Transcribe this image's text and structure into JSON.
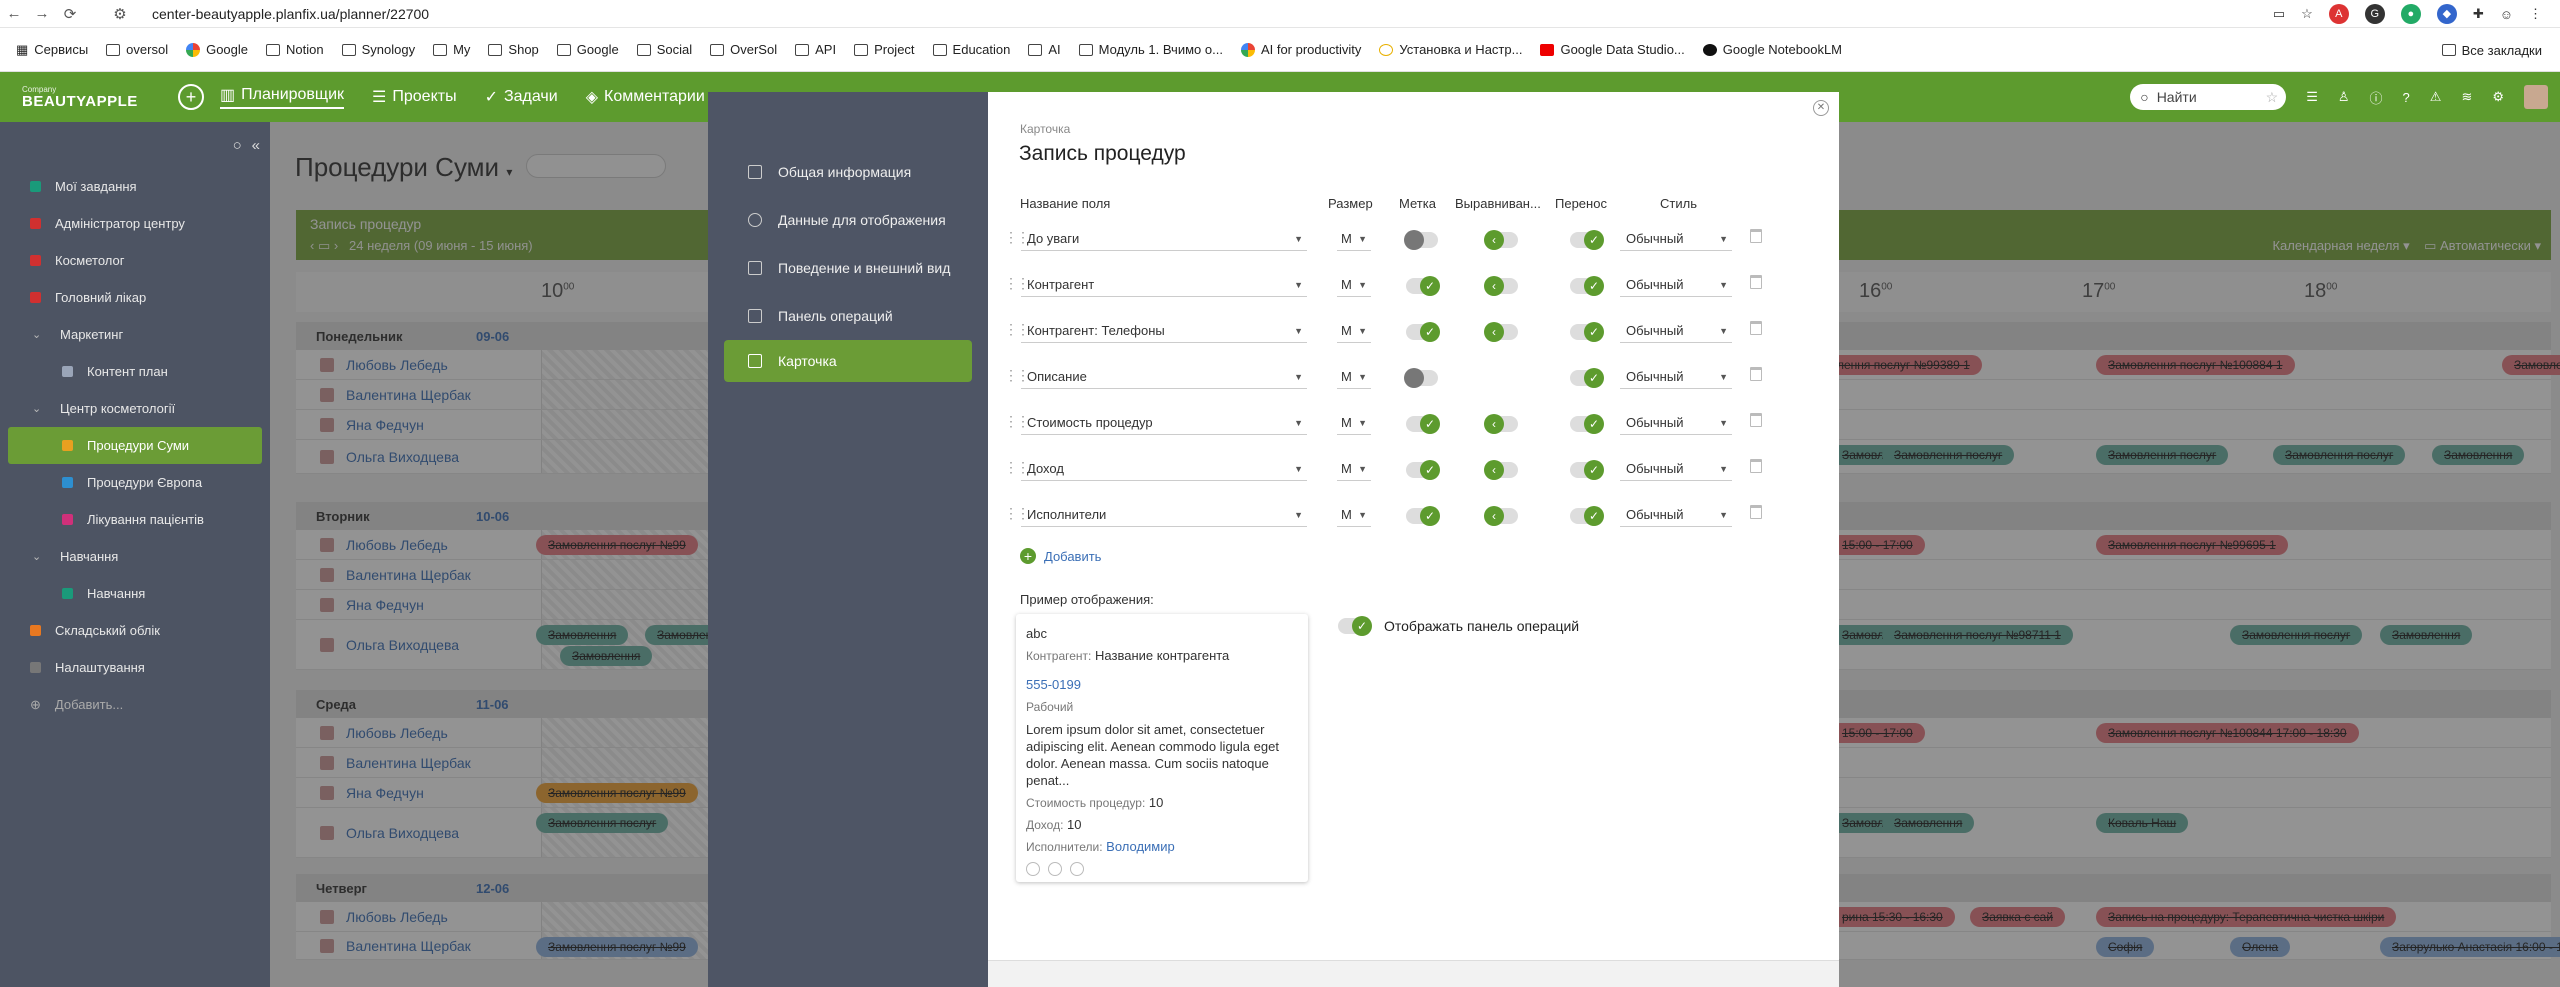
{
  "browser": {
    "url": "center-beautyapple.planfix.ua/planner/22700",
    "bookmarks": [
      "Сервисы",
      "oversol",
      "Google",
      "Notion",
      "Synology",
      "My",
      "Shop",
      "Google",
      "Social",
      "OverSol",
      "API",
      "Project",
      "Education",
      "AI",
      "Модуль 1. Вчимо о...",
      "AI for productivity",
      "Установка и Настр...",
      "Google Data Studio...",
      "Google NotebookLM"
    ],
    "all_bookmarks": "Все закладки"
  },
  "header": {
    "company_small": "Company",
    "company": "BEAUTYAPPLE",
    "nav": [
      "Планировщик",
      "Проекты",
      "Задачи",
      "Комментарии"
    ],
    "search_placeholder": "Найти"
  },
  "sidebar": {
    "items": [
      {
        "label": "Мої завдання",
        "color": "#1a9a7a",
        "kind": "top"
      },
      {
        "label": "Адміністратор центру",
        "color": "#d03030",
        "kind": "top"
      },
      {
        "label": "Косметолог",
        "color": "#d03030",
        "kind": "top"
      },
      {
        "label": "Головний лікар",
        "color": "#d03030",
        "kind": "top"
      },
      {
        "label": "Маркетинг",
        "kind": "group"
      },
      {
        "label": "Контент план",
        "color": "#9aa5b8",
        "kind": "sub"
      },
      {
        "label": "Центр косметології",
        "kind": "group"
      },
      {
        "label": "Процедури Суми",
        "color": "#e8a020",
        "kind": "active"
      },
      {
        "label": "Процедури Європа",
        "color": "#2d8fd0",
        "kind": "sub"
      },
      {
        "label": "Лікування пацієнтів",
        "color": "#d0307a",
        "kind": "sub"
      },
      {
        "label": "Навчання",
        "kind": "group"
      },
      {
        "label": "Навчання",
        "color": "#1a9a7a",
        "kind": "sub"
      },
      {
        "label": "Складський облік",
        "color": "#e87820",
        "kind": "top"
      },
      {
        "label": "Налаштування",
        "color": "#777",
        "kind": "top"
      },
      {
        "label": "Добавить...",
        "kind": "add"
      }
    ]
  },
  "planner": {
    "title": "Процедури Суми",
    "bar_title": "Запись процедур",
    "week": "24 неделя (09 июня - 15 июня)",
    "view": "Календарная неделя",
    "mode": "Автоматически",
    "hours": [
      "10",
      "16",
      "17",
      "18"
    ],
    "days": [
      {
        "name": "Понедельник",
        "date": "09-06"
      },
      {
        "name": "Вторник",
        "date": "10-06"
      },
      {
        "name": "Среда",
        "date": "11-06"
      },
      {
        "name": "Четверг",
        "date": "12-06"
      }
    ],
    "people": [
      "Любовь Лебедь",
      "Валентина Щербак",
      "Яна Федчун",
      "Ольга Виходцева"
    ],
    "events": {
      "e1": "Замовлення послуг №99389 1",
      "e2": "Замовлення послуг №100884 1",
      "e3": "Замовлення послуг №99",
      "e4": "Замовлення",
      "e5": "Замовлення послуг",
      "e6": "Замовлення послуг",
      "e7": "Замовлення послуг",
      "e8": "Замовлення",
      "e9": "Замовлення послуг №99",
      "e10": "15:00 - 17:00",
      "e11": "Замовлення послуг №99695 1",
      "e12": "Замовлення",
      "e13": "Замовлення",
      "e14": "Замовлення",
      "e15": "Замовлення послуг №98711 1",
      "e16": "Замовлення послуг",
      "e17": "Замовлення",
      "e18": "Замовлення",
      "e19": "15:00 - 17:00",
      "e20": "Замовлення послуг №100844 17:00 - 18:30",
      "e21": "Замовлення послуг №99",
      "e22": "Замовлення послуг",
      "e23": "Замовлення",
      "e24": "Замовлення",
      "e25": "Коваль Наш",
      "e26": "рина 15:30 - 16:30",
      "e27": "Заявка с сай",
      "e28": "Запись на процедуру: Терапевтична чистка шкіри",
      "e29": "Замовлення послуг №99",
      "e30": "Софія",
      "e31": "Олена",
      "e32": "Загорулько Анастасія 16:00 - 17"
    }
  },
  "modal": {
    "nav": [
      "Общая информация",
      "Данные для отображения",
      "Поведение и внешний вид",
      "Панель операций",
      "Карточка"
    ],
    "crumb": "Карточка",
    "title": "Запись процедур",
    "cols": {
      "field": "Название поля",
      "size": "Размер",
      "mark": "Метка",
      "align": "Выравниван...",
      "wrap": "Перенос",
      "style": "Стиль"
    },
    "rows": [
      {
        "field": "До уваги",
        "size": "M",
        "style": "Обычный",
        "mark": false,
        "align": true,
        "wrap": true
      },
      {
        "field": "Контрагент",
        "size": "M",
        "style": "Обычный",
        "mark": true,
        "align": true,
        "wrap": true
      },
      {
        "field": "Контрагент: Телефоны",
        "size": "M",
        "style": "Обычный",
        "mark": true,
        "align": true,
        "wrap": true
      },
      {
        "field": "Описание",
        "size": "M",
        "style": "Обычный",
        "mark": false,
        "align": null,
        "wrap": true
      },
      {
        "field": "Стоимость процедур",
        "size": "M",
        "style": "Обычный",
        "mark": true,
        "align": true,
        "wrap": true
      },
      {
        "field": "Доход",
        "size": "M",
        "style": "Обычный",
        "mark": true,
        "align": true,
        "wrap": true
      },
      {
        "field": "Исполнители",
        "size": "M",
        "style": "Обычный",
        "mark": true,
        "align": true,
        "wrap": true
      }
    ],
    "add": "Добавить",
    "example_label": "Пример отображения:",
    "card": {
      "line1": "abc",
      "contractor_label": "Контрагент:",
      "contractor": "Название контрагента",
      "phone": "555-0199",
      "phone_type": "Рабочий",
      "desc": "Lorem ipsum dolor sit amet, consectetuer adipiscing elit. Aenean commodo ligula eget dolor. Aenean massa. Cum sociis natoque penat...",
      "cost_label": "Стоимость процедур:",
      "cost": "10",
      "income_label": "Доход:",
      "income": "10",
      "exec_label": "Исполнители:",
      "exec": "Володимир"
    },
    "panel_toggle": "Отображать панель операций"
  }
}
